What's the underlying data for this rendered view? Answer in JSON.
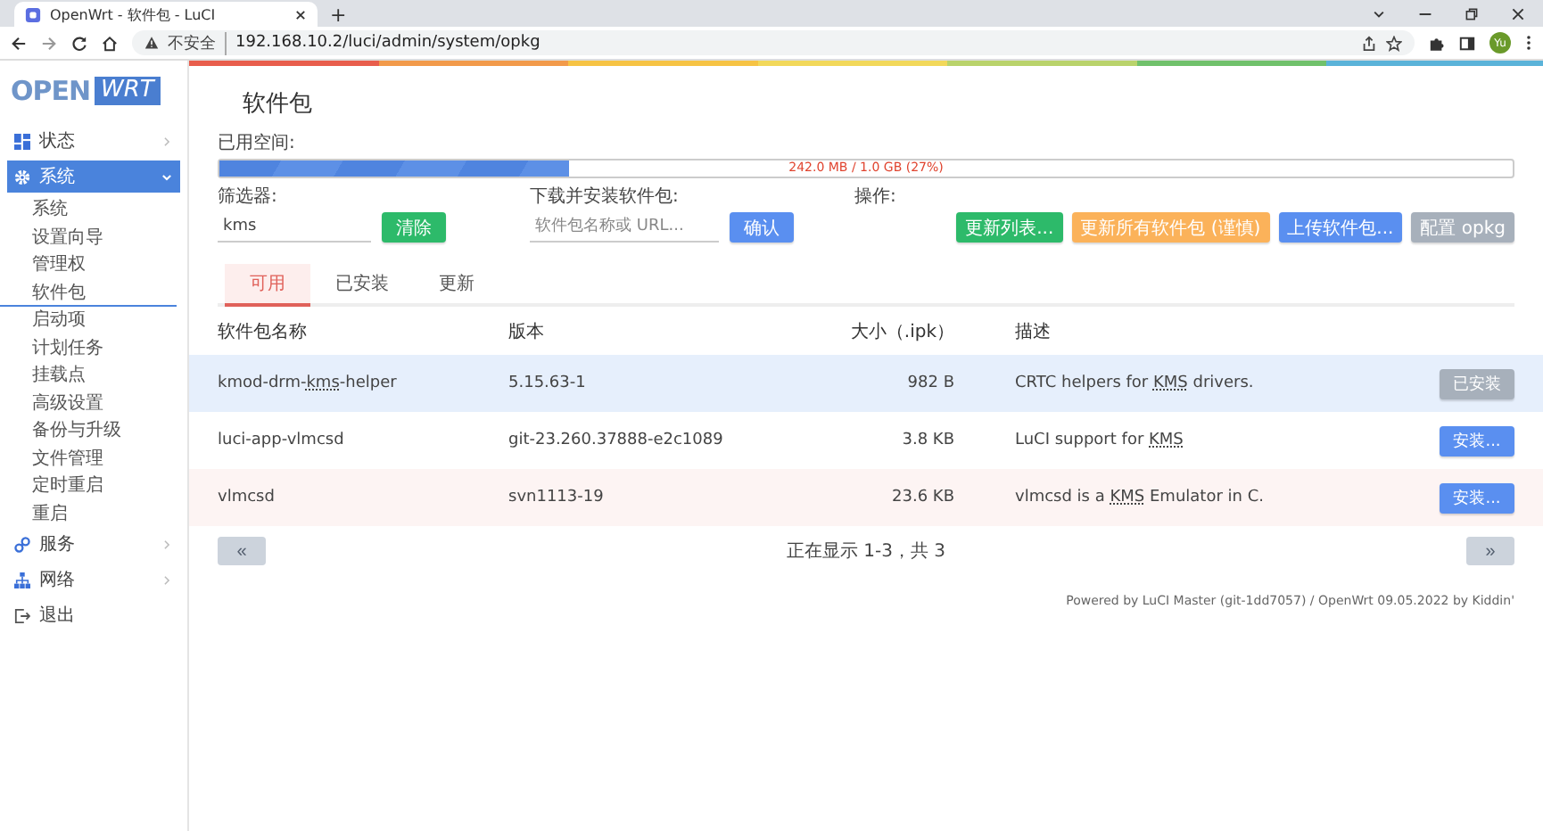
{
  "browser": {
    "tab_title": "OpenWrt - 软件包 - LuCI",
    "new_tab": "+",
    "security": "不安全",
    "url": "192.168.10.2/luci/admin/system/opkg",
    "avatar": "Yu"
  },
  "logo": {
    "left": "OPEN",
    "right": "WRT"
  },
  "sidebar": {
    "items": [
      {
        "label": "状态",
        "kind": "menu",
        "expanded": false
      },
      {
        "label": "系统",
        "kind": "menu",
        "expanded": true,
        "children": [
          {
            "label": "系统",
            "selected": false
          },
          {
            "label": "设置向导",
            "selected": false
          },
          {
            "label": "管理权",
            "selected": false
          },
          {
            "label": "软件包",
            "selected": true
          },
          {
            "label": "启动项",
            "selected": false
          },
          {
            "label": "计划任务",
            "selected": false
          },
          {
            "label": "挂载点",
            "selected": false
          },
          {
            "label": "高级设置",
            "selected": false
          },
          {
            "label": "备份与升级",
            "selected": false
          },
          {
            "label": "文件管理",
            "selected": false
          },
          {
            "label": "定时重启",
            "selected": false
          },
          {
            "label": "重启",
            "selected": false
          }
        ]
      },
      {
        "label": "服务",
        "kind": "menu",
        "expanded": false
      },
      {
        "label": "网络",
        "kind": "menu",
        "expanded": false
      },
      {
        "label": "退出",
        "kind": "link"
      }
    ]
  },
  "page": {
    "title": "软件包",
    "storage": {
      "label": "已用空间:",
      "level": 0.27,
      "reading": "242.0 MB / 1.0 GB (27%)"
    },
    "filter": {
      "label": "筛选器:",
      "value": "kms",
      "button": "清除"
    },
    "install": {
      "label": "下载并安装软件包:",
      "placeholder": "软件包名称或 URL...",
      "button": "确认"
    },
    "actions": {
      "label": "操作:",
      "buttons": [
        {
          "label": "更新列表...",
          "color": "#2dba6a"
        },
        {
          "label": "更新所有软件包 (谨慎)",
          "color": "#fbb25a"
        },
        {
          "label": "上传软件包...",
          "color": "#5a8ff0"
        },
        {
          "label": "配置 opkg",
          "color": "#a7b0bb"
        }
      ]
    },
    "tabs": [
      {
        "label": "可用",
        "selected": true
      },
      {
        "label": "已安装",
        "selected": false
      },
      {
        "label": "更新",
        "selected": false
      }
    ],
    "table": {
      "columns": [
        "软件包名称",
        "版本",
        "大小（.ipk）",
        "描述"
      ],
      "rows": [
        {
          "selected": true,
          "name": [
            {
              "text": "kmod-drm-"
            },
            {
              "text": "kms",
              "abbr": true
            },
            {
              "text": "-helper"
            }
          ],
          "version": "5.15.63-1",
          "size": "982 B",
          "description": [
            {
              "text": "CRTC helpers for "
            },
            {
              "text": "KMS",
              "abbr": true
            },
            {
              "text": " drivers."
            }
          ],
          "action": {
            "label": "已安装",
            "disabled": true
          }
        },
        {
          "selected": false,
          "name": [
            {
              "text": "luci-app-vlmcsd"
            }
          ],
          "version": "git-23.260.37888-e2c1089",
          "size": "3.8 KB",
          "description": [
            {
              "text": "LuCI support for "
            },
            {
              "text": "KMS",
              "abbr": true
            }
          ],
          "action": {
            "label": "安装...",
            "disabled": false
          }
        },
        {
          "selected": false,
          "name": [
            {
              "text": "vlmcsd"
            }
          ],
          "version": "svn1113-19",
          "size": "23.6 KB",
          "description": [
            {
              "text": "vlmcsd is a "
            },
            {
              "text": "KMS",
              "abbr": true
            },
            {
              "text": " Emulator in C."
            }
          ],
          "action": {
            "label": "安装...",
            "disabled": false
          }
        }
      ]
    },
    "pager": {
      "prev": {
        "label": "«",
        "disabled": true
      },
      "status": "正在显示 1-3，共 3",
      "next": {
        "label": "»",
        "disabled": true
      }
    },
    "footer": "Powered by LuCI Master (git-1dd7057) / OpenWrt 09.05.2022 by Kiddin'"
  }
}
